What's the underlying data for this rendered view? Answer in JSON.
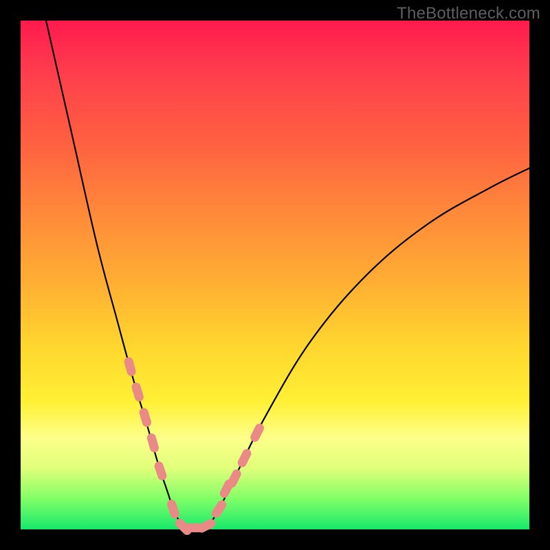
{
  "watermark": "TheBottleneck.com",
  "chart_data": {
    "type": "line",
    "title": "",
    "xlabel": "",
    "ylabel": "",
    "xlim": [
      0,
      100
    ],
    "ylim": [
      0,
      100
    ],
    "grid": false,
    "legend": false,
    "series": [
      {
        "name": "bottleneck-curve",
        "color": "#000000",
        "stroke_width": 2.2,
        "x": [
          5,
          10,
          15,
          19,
          22,
          25,
          27,
          29,
          30,
          31,
          33,
          35,
          37,
          39,
          42,
          48,
          57,
          68,
          80,
          92,
          100
        ],
        "values": [
          100,
          78,
          56,
          41,
          30,
          20,
          13,
          7,
          4,
          2,
          0,
          0,
          1,
          4,
          10,
          22,
          37,
          50,
          60,
          67,
          71
        ]
      },
      {
        "name": "highlight-markers",
        "color": "#e98a86",
        "marker": "capsule",
        "x": [
          21.5,
          23.0,
          24.5,
          26.0,
          27.5,
          30.0,
          32.0,
          34.0,
          36.5,
          39.0,
          40.5,
          42.0,
          44.0,
          46.5
        ],
        "values": [
          32.0,
          27.0,
          22.0,
          17.0,
          11.5,
          4.0,
          0.5,
          0.3,
          0.7,
          4.0,
          8.0,
          10.0,
          14.0,
          19.0
        ]
      }
    ],
    "background_gradient": {
      "top": "#ff1a4d",
      "mid": "#ffd62e",
      "bottom": "#17e86b"
    }
  }
}
